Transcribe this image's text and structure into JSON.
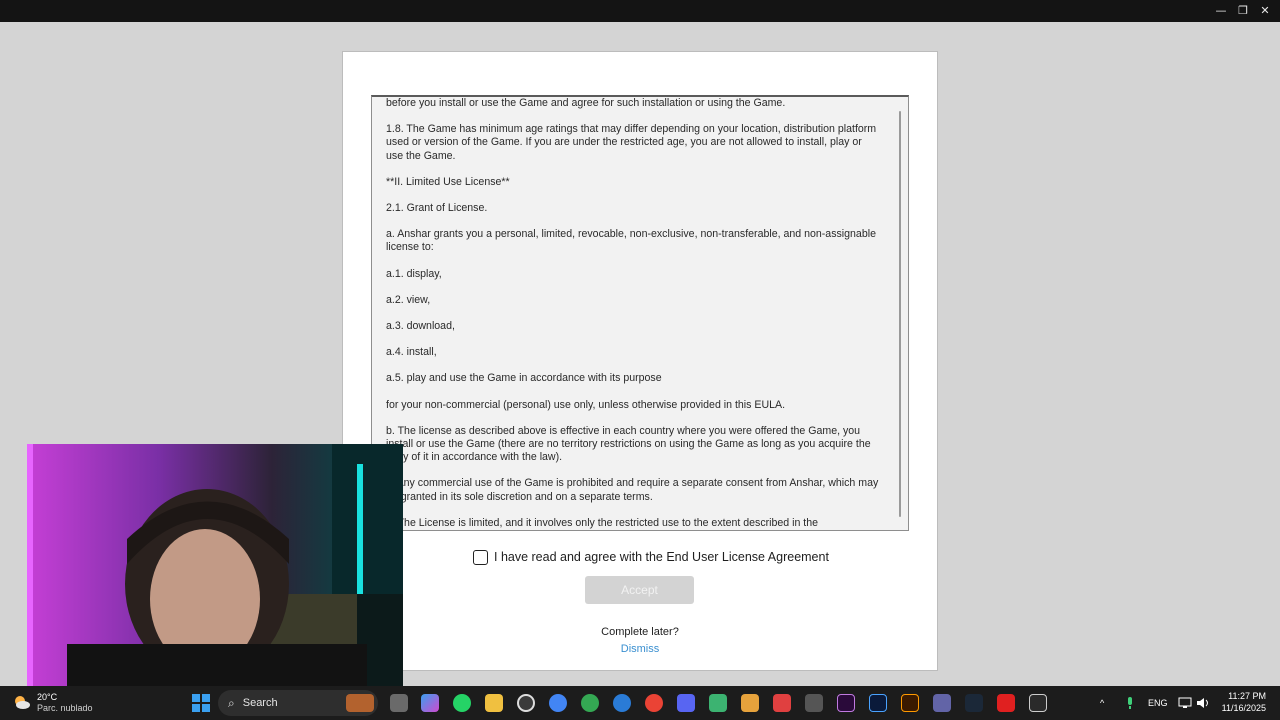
{
  "window": {
    "minimize_glyph": "—",
    "maximize_glyph": "❐",
    "close_glyph": "✕"
  },
  "eula": {
    "paragraphs": [
      "before you install or use the Game and agree for such installation or using the Game.",
      "1.8.    The Game has minimum age ratings that may differ depending on your location, distribution platform used or version of the Game. If you are under the restricted age, you are not allowed to install, play or use the Game.",
      "**II.    Limited Use License**",
      "2.1.    Grant of License.",
      "a.    Anshar grants you a personal, limited, revocable, non-exclusive, non-transferable, and non-assignable license to:",
      "a.1.    display,",
      "a.2.    view,",
      "a.3.    download,",
      "a.4.    install,",
      "a.5.    play and use the Game in accordance with its purpose",
      "for your non-commercial (personal) use only, unless otherwise provided in this EULA.",
      "b.    The license as described above is effective in each country where you were offered the Game, you install or use the Game (there are no territory restrictions on using the Game as long as you acquire the copy of it in accordance with the law).",
      "c.    Any commercial use of the Game is prohibited and require a separate consent from Anshar, which may be granted in its sole discretion and on a separate terms.",
      "d.    The License is limited, and it involves only the restricted use to the extent described in the"
    ]
  },
  "agree": {
    "label": "I have read and agree with the End User License Agreement",
    "checked": false
  },
  "accept_button": {
    "label": "Accept",
    "enabled": false
  },
  "complete_later": {
    "text": "Complete later?",
    "dismiss_label": "Dismiss"
  },
  "taskbar": {
    "weather": {
      "temp": "20°C",
      "condition": "Parc. nublado"
    },
    "search_placeholder": "Search",
    "language": "ENG",
    "time": "11:27 PM",
    "date": "11/16/2025"
  },
  "colors": {
    "dismiss_link": "#3a8fd0",
    "accept_disabled_bg": "#d3d3d3",
    "start_blue": "#3aa0f0"
  },
  "icons": [
    "minimize-icon",
    "maximize-icon",
    "close-icon",
    "checkbox-icon",
    "windows-start-icon",
    "search-icon",
    "weather-icon"
  ]
}
